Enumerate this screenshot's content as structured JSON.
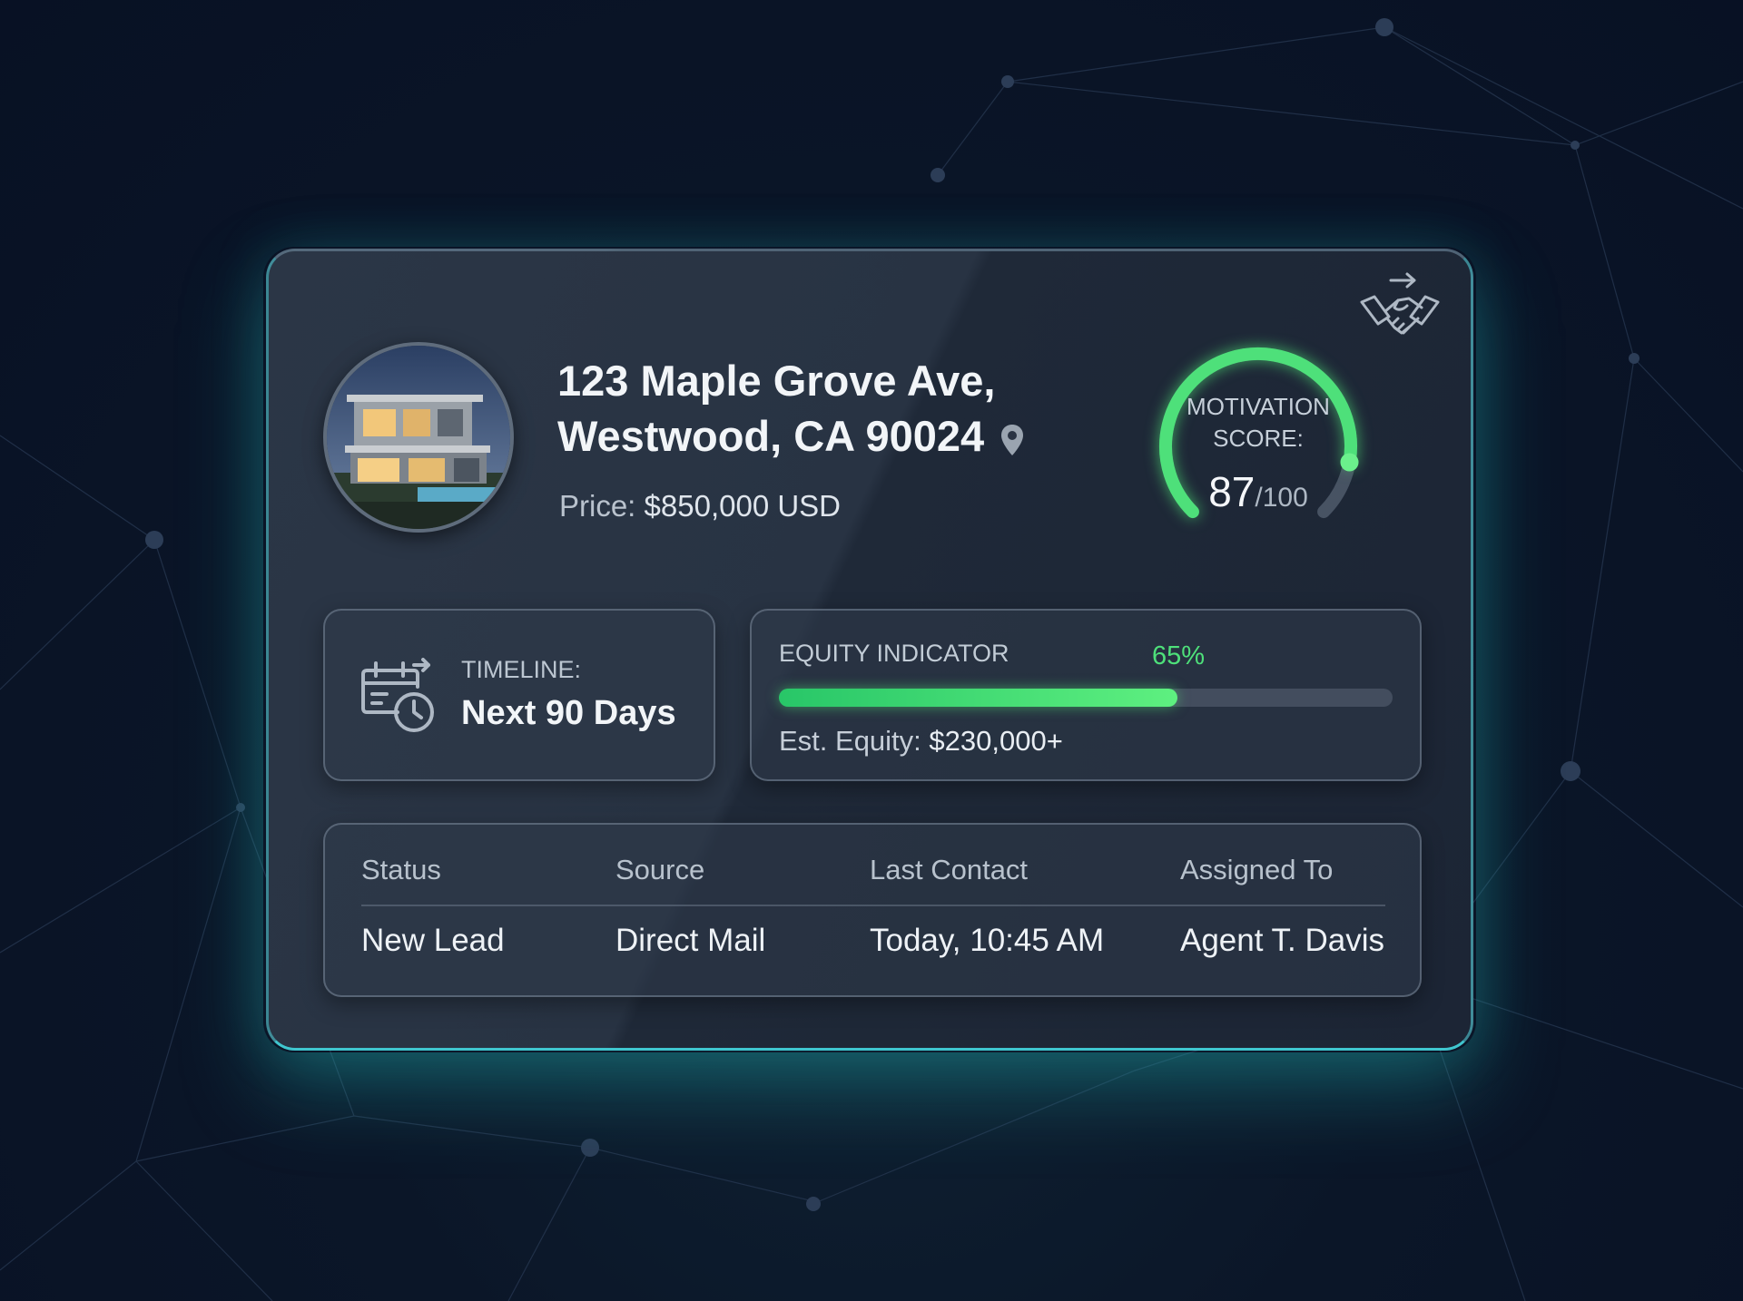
{
  "property": {
    "address_line1": "123 Maple Grove Ave,",
    "address_line2": "Westwood, CA 90024",
    "price_label": "Price:",
    "price_value": "$850,000 USD"
  },
  "motivation": {
    "label_line1": "MOTIVATION",
    "label_line2": "SCORE:",
    "score": "87",
    "max": "/100",
    "fraction": 0.87,
    "accent_color": "#4ee07a"
  },
  "timeline": {
    "label": "TIMELINE:",
    "value": "Next 90 Days"
  },
  "equity": {
    "label": "EQUITY INDICATOR",
    "percent_text": "65%",
    "percent": 0.65,
    "estimate_label": "Est. Equity:",
    "estimate_value": "$230,000+"
  },
  "details": {
    "headers": [
      "Status",
      "Source",
      "Last Contact",
      "Assigned To"
    ],
    "values": [
      "New Lead",
      "Direct Mail",
      "Today, 10:45 AM",
      "Agent T. Davis"
    ]
  },
  "icons": {
    "property_photo": "house-photo",
    "location": "map-pin-icon",
    "deal": "handshake-icon",
    "timeline": "calendar-clock-icon"
  }
}
